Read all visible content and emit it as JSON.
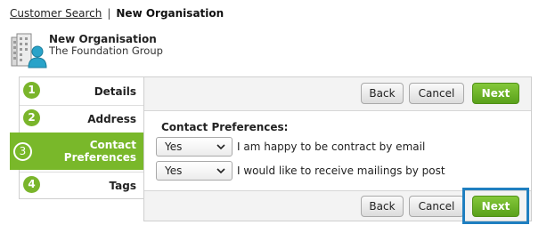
{
  "breadcrumb": {
    "link": "Customer Search",
    "separator": "|",
    "current": "New Organisation"
  },
  "org": {
    "name": "New Organisation",
    "group": "The Foundation Group",
    "icon": "building-person-icon"
  },
  "steps": [
    {
      "number": "1",
      "label": "Details"
    },
    {
      "number": "2",
      "label": "Address"
    },
    {
      "number": "3",
      "label_line1": "Contact",
      "label_line2": "Preferences"
    },
    {
      "number": "4",
      "label": "Tags"
    }
  ],
  "active_step": 3,
  "buttons": {
    "back": "Back",
    "cancel": "Cancel",
    "next": "Next"
  },
  "form": {
    "section_title": "Contact Preferences:",
    "preferences": [
      {
        "value": "Yes",
        "label": "I am happy to be contract by email"
      },
      {
        "value": "Yes",
        "label": "I would like to receive mailings by post"
      }
    ]
  },
  "colors": {
    "accent_green": "#79b82a",
    "highlight_blue": "#1f7fc0"
  }
}
